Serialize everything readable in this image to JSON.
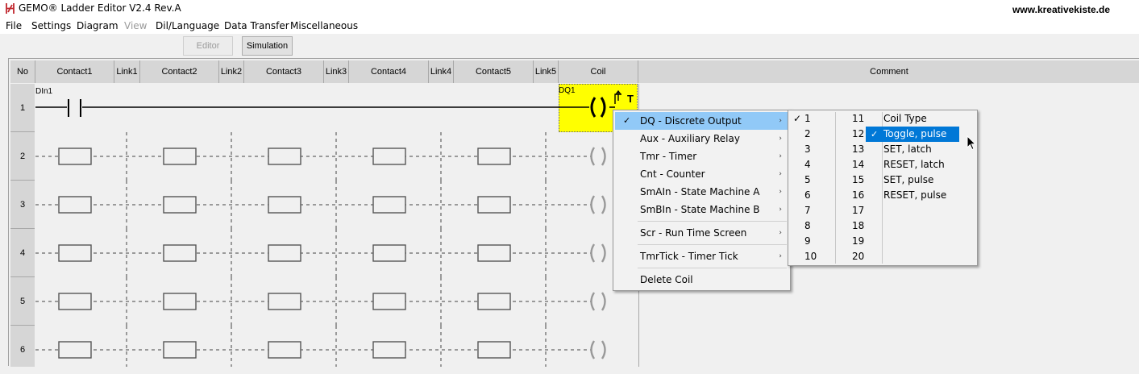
{
  "window": {
    "title": "GEMO® Ladder Editor V2.4 Rev.A",
    "app_icon": "ladder-logo-icon",
    "url_text": "www.kreativekiste.de"
  },
  "menubar": [
    "File",
    "Settings",
    "Diagram",
    "View",
    "Dil/Language",
    "Data Transfer",
    "Miscellaneous"
  ],
  "toolbar": {
    "editor_label": "Editor",
    "simulation_label": "Simulation"
  },
  "grid": {
    "headers": [
      "No",
      "Contact1",
      "Link1",
      "Contact2",
      "Link2",
      "Contact3",
      "Link3",
      "Contact4",
      "Link4",
      "Contact5",
      "Link5",
      "Coil",
      "Comment"
    ],
    "rows": [
      "1",
      "2",
      "3",
      "4",
      "5",
      "6"
    ],
    "rung1": {
      "contact_label": "DIn1",
      "coil_label": "DQ1",
      "coil_flag": "T"
    }
  },
  "context_menu": {
    "items": [
      {
        "label": "DQ  - Discrete Output",
        "checked": true,
        "submenu": true
      },
      {
        "label": "Aux - Auxiliary Relay",
        "submenu": true
      },
      {
        "label": "Tmr - Timer",
        "submenu": true
      },
      {
        "label": "Cnt - Counter",
        "submenu": true
      },
      {
        "label": "SmAIn - State Machine A",
        "submenu": true
      },
      {
        "label": "SmBIn - State Machine B",
        "submenu": true
      },
      {
        "label": "Scr - Run Time Screen",
        "submenu": true
      },
      {
        "label": "TmrTick - Timer Tick",
        "submenu": true
      },
      {
        "label": "Delete Coil",
        "submenu": false
      }
    ],
    "check_mark": "✓",
    "submenu_arrow": "›"
  },
  "number_menu": {
    "col1": [
      "1",
      "2",
      "3",
      "4",
      "5",
      "6",
      "7",
      "8",
      "9",
      "10"
    ],
    "col2": [
      "11",
      "12",
      "13",
      "14",
      "15",
      "16",
      "17",
      "18",
      "19",
      "20"
    ],
    "checked": "1"
  },
  "coil_type_menu": {
    "heading": "Coil Type",
    "items": [
      "Toggle, pulse",
      "SET, latch",
      "RESET, latch",
      "SET, pulse",
      "RESET, pulse"
    ],
    "selected": "Toggle, pulse"
  }
}
